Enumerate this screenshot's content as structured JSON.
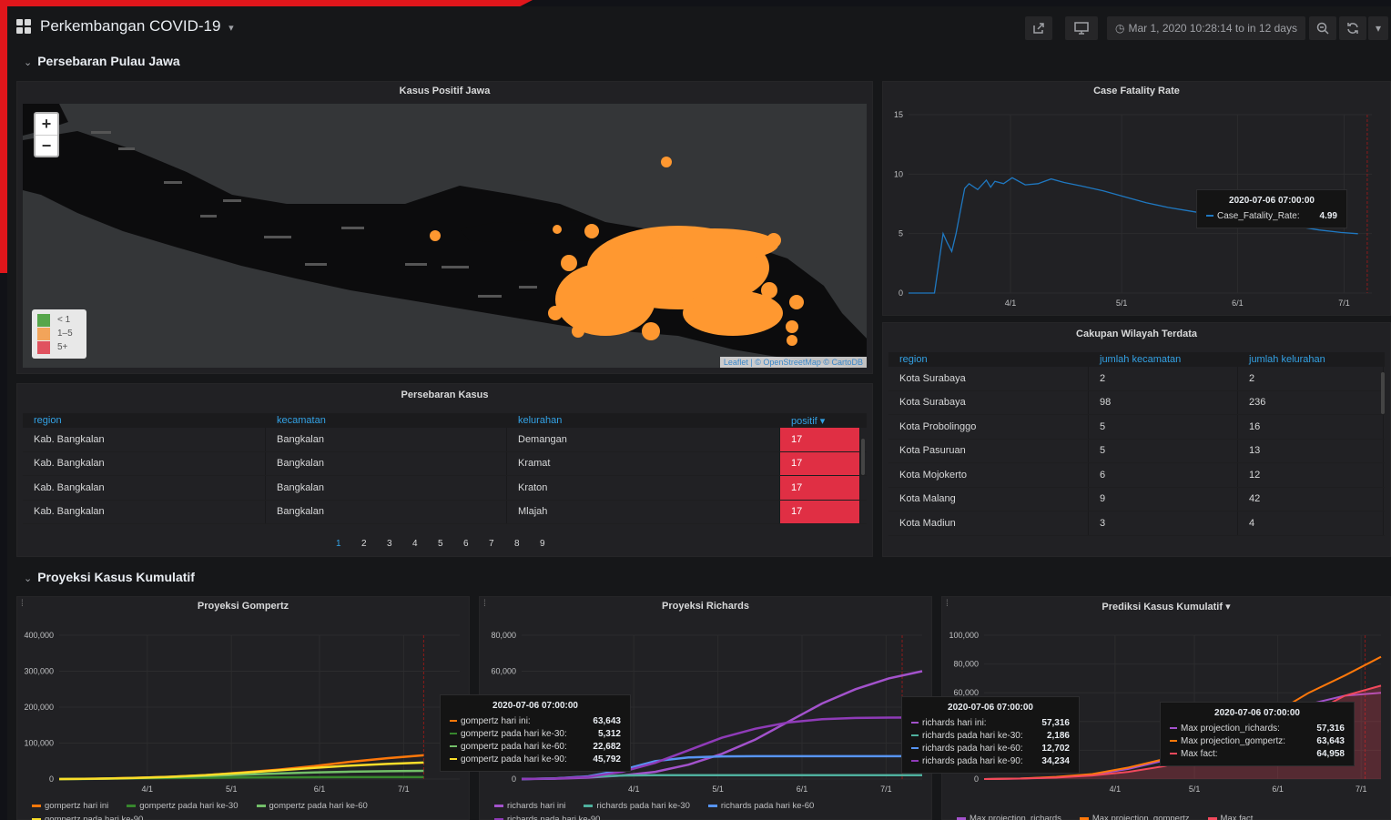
{
  "topbar": {
    "title": "Perkembangan COVID-19",
    "time_range": "Mar 1, 2020 10:28:14 to in 12 days"
  },
  "rows": {
    "row1": "Persebaran Pulau Jawa",
    "row2": "Proyeksi Kasus Kumulatif"
  },
  "map_panel": {
    "title": "Kasus Positif Jawa",
    "zoom_in": "+",
    "zoom_out": "−",
    "legend": [
      {
        "label": "< 1",
        "color": "#56a64b"
      },
      {
        "label": "1–5",
        "color": "#f2a45a"
      },
      {
        "label": "5+",
        "color": "#e0525f"
      }
    ],
    "attribution": "Leaflet | © OpenStreetMap © CartoDB",
    "marker_color": "#ff9830"
  },
  "cfr_panel": {
    "title": "Case Fatality Rate",
    "tooltip": {
      "time": "2020-07-06 07:00:00",
      "series": "Case_Fatality_Rate:",
      "value": "4.99"
    }
  },
  "cakupan_panel": {
    "title": "Cakupan Wilayah Terdata",
    "columns": [
      "region",
      "jumlah kecamatan",
      "jumlah kelurahan"
    ],
    "rows": [
      [
        "Kota Surabaya",
        "2",
        "2"
      ],
      [
        "Kota Surabaya",
        "98",
        "236"
      ],
      [
        "Kota Probolinggo",
        "5",
        "16"
      ],
      [
        "Kota Pasuruan",
        "5",
        "13"
      ],
      [
        "Kota Mojokerto",
        "6",
        "12"
      ],
      [
        "Kota Malang",
        "9",
        "42"
      ],
      [
        "Kota Madiun",
        "3",
        "4"
      ]
    ]
  },
  "sebaran_panel": {
    "title": "Persebaran Kasus",
    "columns": [
      "region",
      "kecamatan",
      "kelurahan",
      "positif ▾"
    ],
    "rows": [
      [
        "Kab. Bangkalan",
        "Bangkalan",
        "Demangan",
        "17"
      ],
      [
        "Kab. Bangkalan",
        "Bangkalan",
        "Kramat",
        "17"
      ],
      [
        "Kab. Bangkalan",
        "Bangkalan",
        "Kraton",
        "17"
      ],
      [
        "Kab. Bangkalan",
        "Bangkalan",
        "Mlajah",
        "17"
      ]
    ],
    "pages": [
      "1",
      "2",
      "3",
      "4",
      "5",
      "6",
      "7",
      "8",
      "9"
    ]
  },
  "gompertz_panel": {
    "title": "Proyeksi Gompertz",
    "tooltip": {
      "time": "2020-07-06 07:00:00",
      "rows": [
        {
          "label": "gompertz hari ini:",
          "value": "63,643",
          "color": "#ff780a"
        },
        {
          "label": "gompertz pada hari ke-30:",
          "value": "5,312",
          "color": "#37872d"
        },
        {
          "label": "gompertz pada hari ke-60:",
          "value": "22,682",
          "color": "#73bf69"
        },
        {
          "label": "gompertz pada hari ke-90:",
          "value": "45,792",
          "color": "#fade2a"
        }
      ]
    },
    "legend": [
      {
        "label": "gompertz hari ini",
        "color": "#ff780a"
      },
      {
        "label": "gompertz pada hari ke-30",
        "color": "#37872d"
      },
      {
        "label": "gompertz pada hari ke-60",
        "color": "#73bf69"
      },
      {
        "label": "gompertz pada hari ke-90",
        "color": "#fade2a"
      }
    ]
  },
  "richards_panel": {
    "title": "Proyeksi Richards",
    "tooltip": {
      "time": "2020-07-06 07:00:00",
      "rows": [
        {
          "label": "richards hari ini:",
          "value": "57,316",
          "color": "#a352cc"
        },
        {
          "label": "richards pada hari ke-30:",
          "value": "2,186",
          "color": "#4fb09e"
        },
        {
          "label": "richards pada hari ke-60:",
          "value": "12,702",
          "color": "#5794f2"
        },
        {
          "label": "richards pada hari ke-90:",
          "value": "34,234",
          "color": "#8f3bb8"
        }
      ]
    },
    "legend": [
      {
        "label": "richards hari ini",
        "color": "#a352cc"
      },
      {
        "label": "richards pada hari ke-30",
        "color": "#4fb09e"
      },
      {
        "label": "richards pada hari ke-60",
        "color": "#5794f2"
      },
      {
        "label": "richards pada hari ke-90",
        "color": "#8f3bb8"
      }
    ]
  },
  "prediksi_panel": {
    "title": "Prediksi Kasus Kumulatif ▾",
    "tooltip": {
      "time": "2020-07-06 07:00:00",
      "rows": [
        {
          "label": "Max projection_richards:",
          "value": "57,316",
          "color": "#a352cc"
        },
        {
          "label": "Max projection_gompertz:",
          "value": "63,643",
          "color": "#ff780a"
        },
        {
          "label": "Max fact:",
          "value": "64,958",
          "color": "#f2495c"
        }
      ]
    },
    "legend": [
      {
        "label": "Max projection_richards",
        "color": "#a352cc"
      },
      {
        "label": "Max projection_gompertz",
        "color": "#ff780a"
      },
      {
        "label": "Max fact",
        "color": "#f2495c"
      }
    ]
  },
  "chart_data": [
    {
      "type": "line",
      "title": "Case Fatality Rate",
      "ylim": [
        0,
        15
      ],
      "yticks": [
        "0",
        "5",
        "10",
        "15"
      ],
      "xticks": [
        "4/1",
        "5/1",
        "6/1",
        "7/1"
      ],
      "series": [
        {
          "name": "Case_Fatality_Rate",
          "color": "#1f78c1",
          "points": [
            [
              0,
              0
            ],
            [
              6,
              0
            ],
            [
              8,
              5
            ],
            [
              9,
              4.2
            ],
            [
              10,
              3.5
            ],
            [
              11,
              5
            ],
            [
              13,
              8.8
            ],
            [
              14,
              9.2
            ],
            [
              16,
              8.7
            ],
            [
              18,
              9.5
            ],
            [
              19,
              8.9
            ],
            [
              20,
              9.4
            ],
            [
              22,
              9.2
            ],
            [
              24,
              9.7
            ],
            [
              27,
              9.1
            ],
            [
              30,
              9.2
            ],
            [
              33,
              9.6
            ],
            [
              36,
              9.3
            ],
            [
              40,
              9.0
            ],
            [
              45,
              8.6
            ],
            [
              50,
              8.1
            ],
            [
              55,
              7.6
            ],
            [
              60,
              7.2
            ],
            [
              65,
              6.9
            ],
            [
              70,
              6.6
            ],
            [
              75,
              6.3
            ],
            [
              80,
              6.0
            ],
            [
              85,
              5.8
            ],
            [
              90,
              5.6
            ],
            [
              95,
              5.3
            ],
            [
              100,
              5.1
            ],
            [
              104,
              4.99
            ]
          ]
        }
      ],
      "grid": true
    },
    {
      "type": "line",
      "title": "Proyeksi Gompertz",
      "ylim": [
        0,
        400000
      ],
      "yticks": [
        "0",
        "100,000",
        "200,000",
        "300,000",
        "400,000"
      ],
      "xticks": [
        "4/1",
        "5/1",
        "6/1",
        "7/1"
      ],
      "series": [
        {
          "name": "gompertz hari ini",
          "color": "#ff780a",
          "values": [
            0,
            1000,
            3000,
            6000,
            11000,
            18000,
            26000,
            36000,
            48000,
            58000,
            66000
          ]
        },
        {
          "name": "gompertz pada hari ke-30",
          "color": "#37872d",
          "values": [
            0,
            800,
            1800,
            2800,
            3600,
            4200,
            4700,
            5000,
            5200,
            5300,
            5312
          ]
        },
        {
          "name": "gompertz pada hari ke-60",
          "color": "#73bf69",
          "values": [
            0,
            800,
            2500,
            5000,
            8500,
            12000,
            15500,
            18500,
            20500,
            21800,
            22682
          ]
        },
        {
          "name": "gompertz pada hari ke-90",
          "color": "#fade2a",
          "values": [
            0,
            900,
            2800,
            6000,
            11000,
            17000,
            24000,
            31000,
            37500,
            42000,
            45792
          ]
        }
      ],
      "grid": true
    },
    {
      "type": "line",
      "title": "Proyeksi Richards",
      "ylim": [
        0,
        80000
      ],
      "yticks": [
        "0",
        "20,000",
        "40,000",
        "60,000",
        "80,000"
      ],
      "xticks": [
        "4/1",
        "5/1",
        "6/1",
        "7/1"
      ],
      "series": [
        {
          "name": "richards hari ini",
          "color": "#a352cc",
          "values": [
            0,
            200,
            800,
            2000,
            4000,
            8000,
            14000,
            22000,
            32000,
            42000,
            50000,
            56000,
            60000
          ]
        },
        {
          "name": "richards pada hari ke-30",
          "color": "#4fb09e",
          "values": [
            0,
            400,
            1200,
            2000,
            2150,
            2186,
            2186,
            2186,
            2186,
            2186,
            2186,
            2186,
            2186
          ]
        },
        {
          "name": "richards pada hari ke-60",
          "color": "#5794f2",
          "values": [
            0,
            300,
            1500,
            5000,
            10000,
            12000,
            12600,
            12702,
            12702,
            12702,
            12702,
            12702,
            12702
          ]
        },
        {
          "name": "richards pada hari ke-90",
          "color": "#8f3bb8",
          "values": [
            0,
            300,
            1200,
            4000,
            9000,
            16000,
            23000,
            28000,
            31500,
            33300,
            34000,
            34200,
            34234
          ]
        }
      ],
      "grid": true
    },
    {
      "type": "line",
      "title": "Prediksi Kasus Kumulatif",
      "ylim": [
        0,
        100000
      ],
      "yticks": [
        "0",
        "20,000",
        "40,000",
        "60,000",
        "80,000",
        "100,000"
      ],
      "xticks": [
        "4/1",
        "5/1",
        "6/1",
        "7/1"
      ],
      "series": [
        {
          "name": "Max projection_richards",
          "color": "#a352cc",
          "values": [
            0,
            300,
            1200,
            3000,
            7000,
            13000,
            22000,
            32000,
            42000,
            52000,
            58000,
            60000
          ]
        },
        {
          "name": "Max projection_gompertz",
          "color": "#ff780a",
          "values": [
            0,
            400,
            1500,
            3500,
            8000,
            14000,
            23000,
            33000,
            45000,
            60000,
            72000,
            85000
          ]
        },
        {
          "name": "Max fact",
          "color": "#f2495c",
          "values": [
            0,
            300,
            1000,
            2500,
            5000,
            9000,
            15000,
            22000,
            32000,
            45000,
            58000,
            64958
          ]
        }
      ],
      "grid": true
    }
  ]
}
